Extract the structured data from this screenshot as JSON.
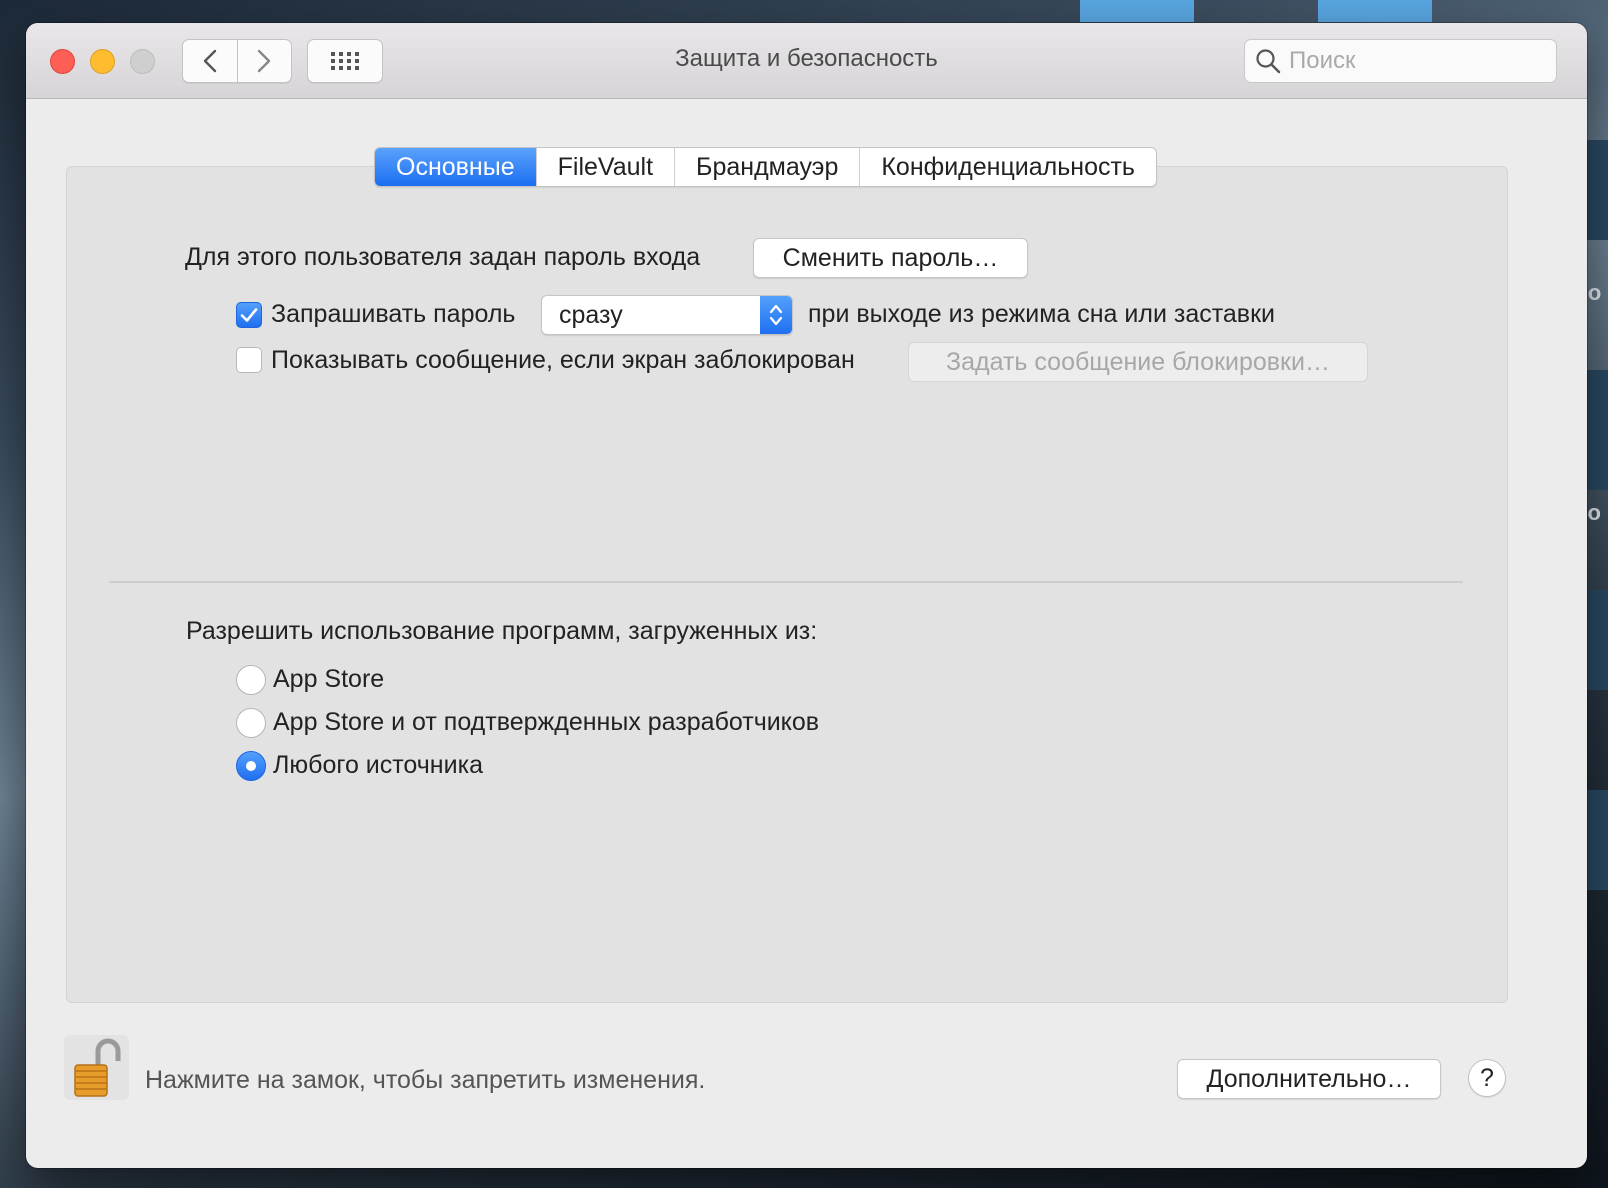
{
  "window": {
    "title": "Защита и безопасность",
    "search_placeholder": "Поиск"
  },
  "tabs": [
    {
      "label": "Основные",
      "active": true
    },
    {
      "label": "FileVault",
      "active": false
    },
    {
      "label": "Брандмауэр",
      "active": false
    },
    {
      "label": "Конфиденциальность",
      "active": false
    }
  ],
  "general": {
    "password_text": "Для этого пользователя задан пароль входа",
    "change_password_button": "Сменить пароль…",
    "require_password": {
      "label": "Запрашивать пароль",
      "checked": true,
      "select_value": "сразу",
      "suffix": "при выходе из режима сна или заставки"
    },
    "show_message": {
      "label": "Показывать сообщение, если экран заблокирован",
      "checked": false,
      "button": "Задать сообщение блокировки…"
    }
  },
  "apps": {
    "heading": "Разрешить использование программ, загруженных из:",
    "options": [
      {
        "label": "App Store",
        "selected": false
      },
      {
        "label": "App Store и от подтвержденных разработчиков",
        "selected": false
      },
      {
        "label": "Любого источника",
        "selected": true
      }
    ]
  },
  "footer": {
    "lock_text": "Нажмите на замок, чтобы запретить изменения.",
    "advanced_button": "Дополнительно…",
    "help_label": "?"
  },
  "desktop": {
    "edge_text_1": "Но",
    "edge_text_2": "ро"
  },
  "colors": {
    "accent": "#1f6ff1",
    "close": "#fd5f57",
    "minimize": "#febc2e"
  }
}
